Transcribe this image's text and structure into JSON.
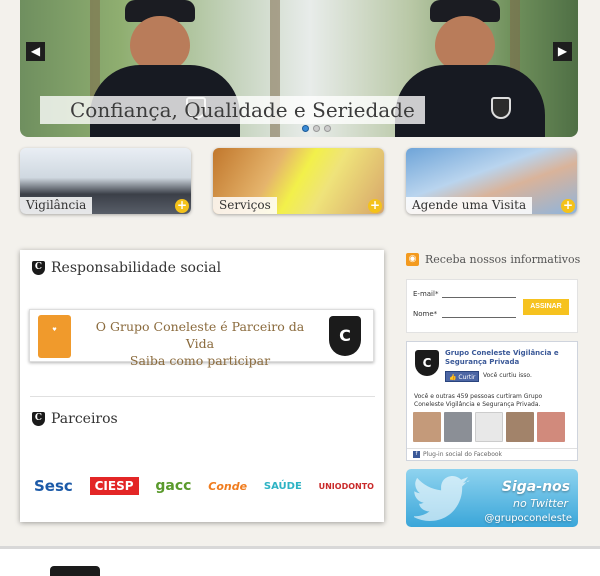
{
  "hero": {
    "caption": "Confiança, Qualidade e Seriedade",
    "prev_icon": "chevron-left-icon",
    "next_icon": "chevron-right-icon",
    "slides_total": 3,
    "slide_active": 1
  },
  "tiles": [
    {
      "label": "Vigilância"
    },
    {
      "label": "Serviços"
    },
    {
      "label": "Agende uma Visita"
    }
  ],
  "social": {
    "title": "Responsabilidade social",
    "banner_line1": "O Grupo Coneleste é Parceiro da Vida",
    "banner_line2": "Saiba como participar"
  },
  "partners": {
    "title": "Parceiros",
    "logos": [
      {
        "name": "sesc",
        "text": "Sesc",
        "color": "#1c5aa8"
      },
      {
        "name": "ciesp",
        "text": "CIESP",
        "color": "#e32626"
      },
      {
        "name": "gacc",
        "text": "gacc",
        "color": "#5a9a2c"
      },
      {
        "name": "farma-conde",
        "text": "Conde",
        "color": "#f07c1e"
      },
      {
        "name": "santa-casa-saude",
        "text": "SAÚDE",
        "color": "#2db3c4"
      },
      {
        "name": "uniodonto",
        "text": "UNIODONTO",
        "color": "#c92a2a"
      }
    ]
  },
  "newsletter": {
    "title": "Receba nossos informativos",
    "email_label": "E-mail*",
    "name_label": "Nome*",
    "button": "ASSINAR"
  },
  "facebook": {
    "page_name": "Grupo Coneleste Vigilância e Segurança Privada",
    "like_button": "Curtir",
    "liked_text": "Você curtiu isso.",
    "count_text": "Você e outras 459 pessoas curtiram Grupo Coneleste Vigilância e Segurança Privada.",
    "plugin_label": "Plug-in social do Facebook"
  },
  "twitter": {
    "line1": "Siga-nos",
    "line2": "no Twitter",
    "handle": "@grupoconeleste"
  },
  "colors": {
    "accent": "#f6c21f",
    "facebook": "#3b5998",
    "twitter": "#3aa6d9"
  }
}
